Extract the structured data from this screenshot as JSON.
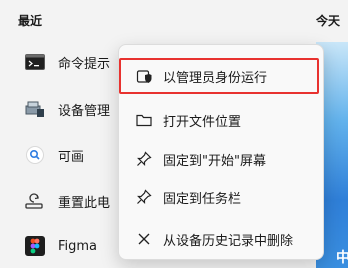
{
  "header": {
    "recent": "最近",
    "today": "今天"
  },
  "recent_items": [
    {
      "label": "命令提示",
      "icon": "cmd-icon"
    },
    {
      "label": "设备管理",
      "icon": "device-manager-icon"
    },
    {
      "label": "可画",
      "icon": "canva-icon"
    },
    {
      "label": "重置此电",
      "icon": "reset-pc-icon"
    },
    {
      "label": "Figma",
      "icon": "figma-icon"
    }
  ],
  "context_menu": {
    "items": [
      {
        "label": "以管理员身份运行",
        "icon": "shield-icon"
      },
      {
        "label": "打开文件位置",
        "icon": "folder-icon"
      },
      {
        "label": "固定到\"开始\"屏幕",
        "icon": "pin-icon"
      },
      {
        "label": "固定到任务栏",
        "icon": "pin-icon"
      },
      {
        "label": "从设备历史记录中删除",
        "icon": "close-icon"
      }
    ]
  },
  "thumbnail": {
    "glyph": "中"
  },
  "colors": {
    "highlight_border": "#e8322f",
    "menu_bg": "#f9f9f9",
    "page_bg": "#f3f3f3"
  }
}
